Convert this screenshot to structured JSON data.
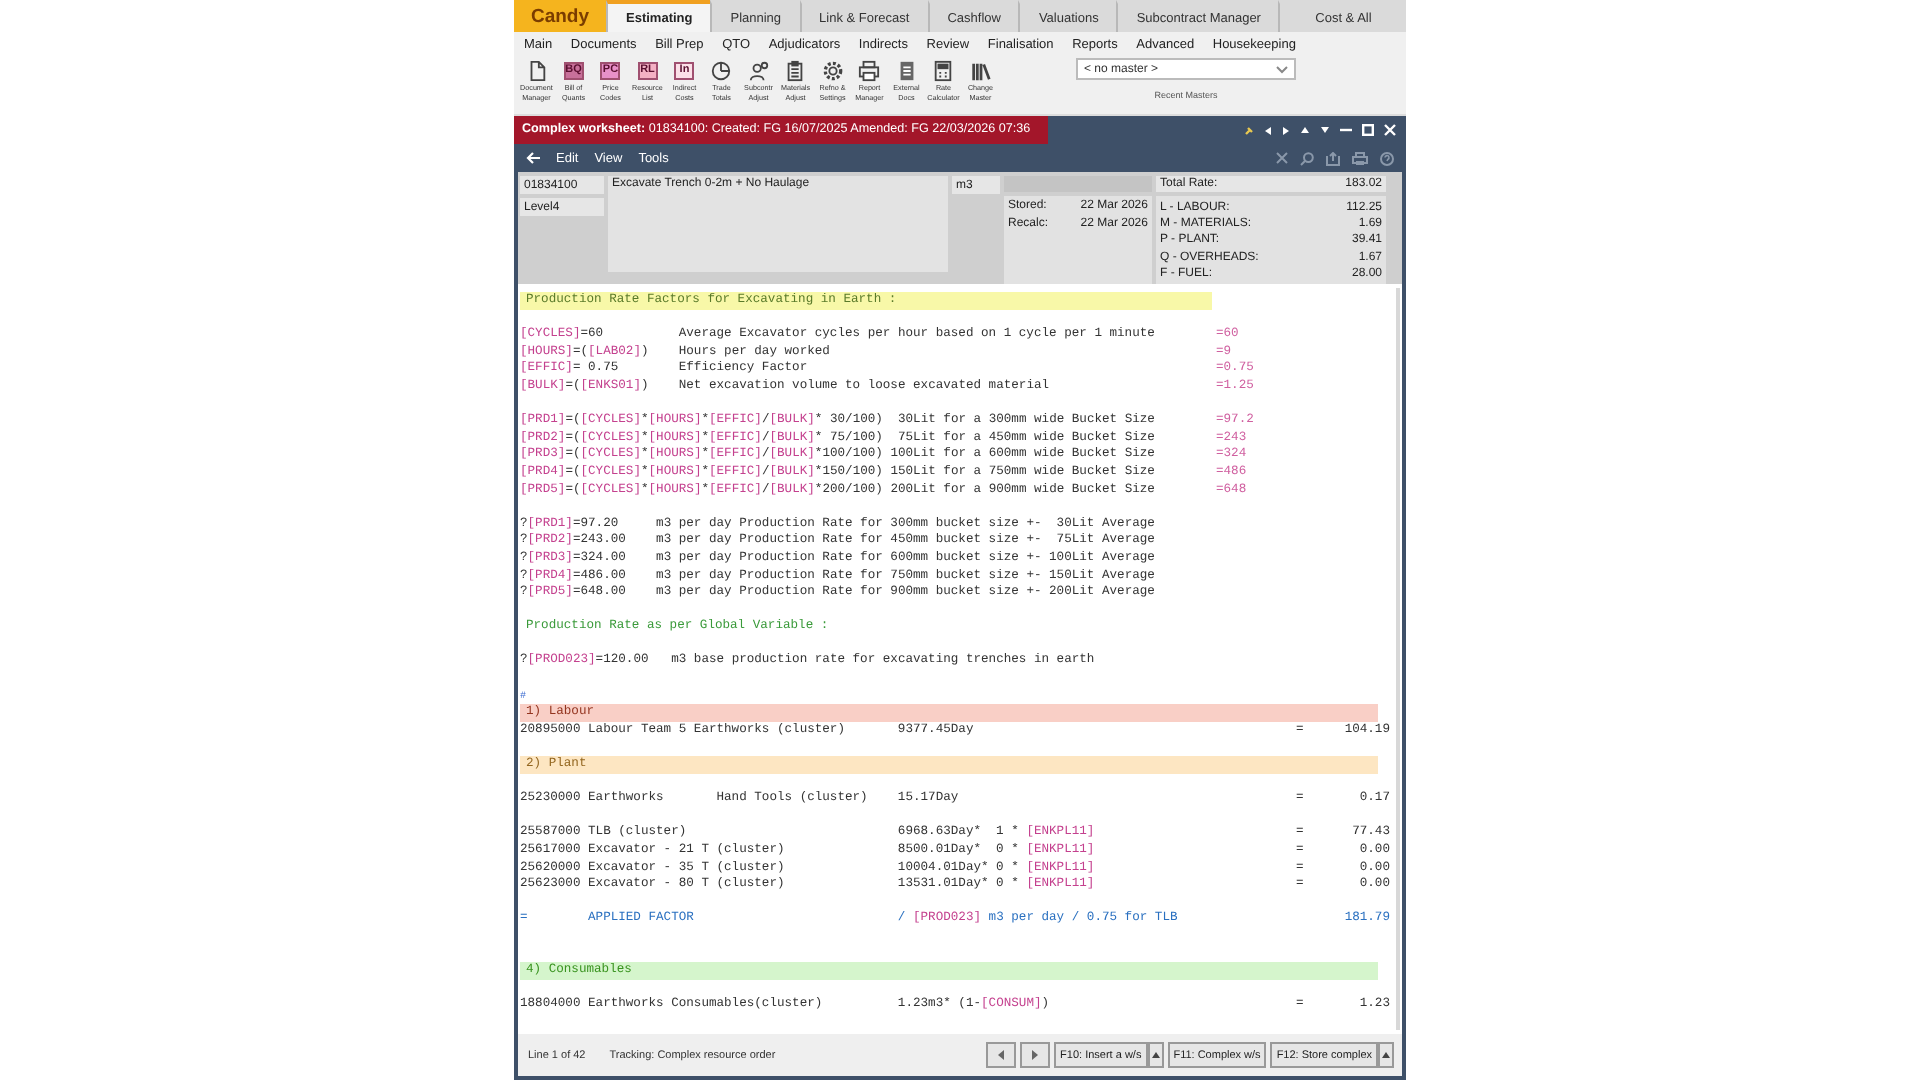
{
  "app": {
    "logo": "Candy"
  },
  "tabs": [
    {
      "label": "Estimating",
      "selected": true
    },
    {
      "label": "Planning",
      "selected": false
    },
    {
      "label": "Link & Forecast",
      "selected": false
    },
    {
      "label": "Cashflow",
      "selected": false
    },
    {
      "label": "Valuations",
      "selected": false
    },
    {
      "label": "Subcontract Manager",
      "selected": false
    },
    {
      "label": "Cost & All",
      "selected": false
    }
  ],
  "menu": [
    "Main",
    "Documents",
    "Bill Prep",
    "QTO",
    "Adjudicators",
    "Indirects",
    "Review",
    "Finalisation",
    "Reports",
    "Advanced",
    "Housekeeping"
  ],
  "ribbon": {
    "tools": [
      {
        "label": "Document Manager",
        "kind": "document"
      },
      {
        "label": "Bill of Quants",
        "kind": "badge",
        "badge": "BQ",
        "color": "#c8709a"
      },
      {
        "label": "Price Codes",
        "kind": "badge",
        "badge": "PC",
        "color": "#e890c8"
      },
      {
        "label": "Resource List",
        "kind": "badge",
        "badge": "RL",
        "color": "#f4b0c4"
      },
      {
        "label": "Indirect Costs",
        "kind": "badge",
        "badge": "In",
        "color": "#fbe0e8"
      },
      {
        "label": "Trade Totals",
        "kind": "pie"
      },
      {
        "label": "Subcontr Adjust",
        "kind": "people"
      },
      {
        "label": "Materials Adjust",
        "kind": "clipboard"
      },
      {
        "label": "Refno & Settings",
        "kind": "gear"
      },
      {
        "label": "Report Manager",
        "kind": "printer"
      },
      {
        "label": "External Docs",
        "kind": "file"
      },
      {
        "label": "Rate Calculator",
        "kind": "calculator"
      },
      {
        "label": "Change Master",
        "kind": "books"
      }
    ],
    "master_select": {
      "value": "< no master >"
    },
    "caption": "Recent Masters"
  },
  "worksheet": {
    "title": "**Complex worksheet:** 01834100: Created: FG 16/07/2025 Amended: FG 22/03/2026 07:36",
    "menu": [
      "Edit",
      "View",
      "Tools"
    ],
    "header": {
      "code": "01834100",
      "level": "Level4",
      "description": "Excavate Trench 0-2m + No Haulage",
      "unit": "m3",
      "dates": [
        {
          "label": "Stored:",
          "value": "22 Mar 2026"
        },
        {
          "label": "Recalc:",
          "value": "22 Mar 2026"
        }
      ],
      "total": {
        "label": "Total Rate:",
        "value": "183.02"
      },
      "breakdown": [
        {
          "label": "L - LABOUR:",
          "value": "112.25"
        },
        {
          "label": "M - MATERIALS:",
          "value": "1.69"
        },
        {
          "label": "P - PLANT:",
          "value": "39.41"
        },
        {
          "label": "Q - OVERHEADS:",
          "value": "1.67"
        },
        {
          "label": "F - FUEL:",
          "value": "28.00"
        }
      ]
    },
    "lines": [
      {
        "kind": "heading",
        "text": "Production Rate Factors for Excavating in Earth :"
      },
      {
        "kind": "blank"
      },
      {
        "kind": "code",
        "segments": [
          {
            "kind": "var",
            "text": "[CYCLES]"
          },
          {
            "kind": "text",
            "text": "=60          Average Excavator cycles per hour based on 1 cycle per 1 minute"
          }
        ],
        "result": "=60"
      },
      {
        "kind": "code",
        "segments": [
          {
            "kind": "var",
            "text": "[HOURS]"
          },
          {
            "kind": "text",
            "text": "=("
          },
          {
            "kind": "var",
            "text": "[LAB02]"
          },
          {
            "kind": "text",
            "text": ")    Hours per day worked"
          }
        ],
        "result": "=9"
      },
      {
        "kind": "code",
        "segments": [
          {
            "kind": "var",
            "text": "[EFFIC]"
          },
          {
            "kind": "text",
            "text": "= 0.75        Efficiency Factor"
          }
        ],
        "result": "=0.75"
      },
      {
        "kind": "code",
        "segments": [
          {
            "kind": "var",
            "text": "[BULK]"
          },
          {
            "kind": "text",
            "text": "=("
          },
          {
            "kind": "var",
            "text": "[ENKS01]"
          },
          {
            "kind": "text",
            "text": ")    Net excavation volume to loose excavated material"
          }
        ],
        "result": "=1.25"
      },
      {
        "kind": "blank"
      },
      {
        "kind": "code",
        "segments": [
          {
            "kind": "var",
            "text": "[PRD1]"
          },
          {
            "kind": "text",
            "text": "=("
          },
          {
            "kind": "var",
            "text": "[CYCLES]"
          },
          {
            "kind": "text",
            "text": "*"
          },
          {
            "kind": "var",
            "text": "[HOURS]"
          },
          {
            "kind": "text",
            "text": "*"
          },
          {
            "kind": "var",
            "text": "[EFFIC]"
          },
          {
            "kind": "text",
            "text": "/"
          },
          {
            "kind": "var",
            "text": "[BULK]"
          },
          {
            "kind": "text",
            "text": "* 30/100)  30Lit for a 300mm wide Bucket Size"
          }
        ],
        "result": "=97.2"
      },
      {
        "kind": "code",
        "segments": [
          {
            "kind": "var",
            "text": "[PRD2]"
          },
          {
            "kind": "text",
            "text": "=("
          },
          {
            "kind": "var",
            "text": "[CYCLES]"
          },
          {
            "kind": "text",
            "text": "*"
          },
          {
            "kind": "var",
            "text": "[HOURS]"
          },
          {
            "kind": "text",
            "text": "*"
          },
          {
            "kind": "var",
            "text": "[EFFIC]"
          },
          {
            "kind": "text",
            "text": "/"
          },
          {
            "kind": "var",
            "text": "[BULK]"
          },
          {
            "kind": "text",
            "text": "* 75/100)  75Lit for a 450mm wide Bucket Size"
          }
        ],
        "result": "=243"
      },
      {
        "kind": "code",
        "segments": [
          {
            "kind": "var",
            "text": "[PRD3]"
          },
          {
            "kind": "text",
            "text": "=("
          },
          {
            "kind": "var",
            "text": "[CYCLES]"
          },
          {
            "kind": "text",
            "text": "*"
          },
          {
            "kind": "var",
            "text": "[HOURS]"
          },
          {
            "kind": "text",
            "text": "*"
          },
          {
            "kind": "var",
            "text": "[EFFIC]"
          },
          {
            "kind": "text",
            "text": "/"
          },
          {
            "kind": "var",
            "text": "[BULK]"
          },
          {
            "kind": "text",
            "text": "*100/100) 100Lit for a 600mm wide Bucket Size"
          }
        ],
        "result": "=324"
      },
      {
        "kind": "code",
        "segments": [
          {
            "kind": "var",
            "text": "[PRD4]"
          },
          {
            "kind": "text",
            "text": "=("
          },
          {
            "kind": "var",
            "text": "[CYCLES]"
          },
          {
            "kind": "text",
            "text": "*"
          },
          {
            "kind": "var",
            "text": "[HOURS]"
          },
          {
            "kind": "text",
            "text": "*"
          },
          {
            "kind": "var",
            "text": "[EFFIC]"
          },
          {
            "kind": "text",
            "text": "/"
          },
          {
            "kind": "var",
            "text": "[BULK]"
          },
          {
            "kind": "text",
            "text": "*150/100) 150Lit for a 750mm wide Bucket Size"
          }
        ],
        "result": "=486"
      },
      {
        "kind": "code",
        "segments": [
          {
            "kind": "var",
            "text": "[PRD5]"
          },
          {
            "kind": "text",
            "text": "=("
          },
          {
            "kind": "var",
            "text": "[CYCLES]"
          },
          {
            "kind": "text",
            "text": "*"
          },
          {
            "kind": "var",
            "text": "[HOURS]"
          },
          {
            "kind": "text",
            "text": "*"
          },
          {
            "kind": "var",
            "text": "[EFFIC]"
          },
          {
            "kind": "text",
            "text": "/"
          },
          {
            "kind": "var",
            "text": "[BULK]"
          },
          {
            "kind": "text",
            "text": "*200/100) 200Lit for a 900mm wide Bucket Size"
          }
        ],
        "result": "=648"
      },
      {
        "kind": "blank"
      },
      {
        "kind": "code",
        "segments": [
          {
            "kind": "text",
            "text": "?"
          },
          {
            "kind": "var",
            "text": "[PRD1]"
          },
          {
            "kind": "text",
            "text": "=97.20     m3 per day Production Rate for 300mm bucket size +-  30Lit Average"
          }
        ]
      },
      {
        "kind": "code",
        "segments": [
          {
            "kind": "text",
            "text": "?"
          },
          {
            "kind": "var",
            "text": "[PRD2]"
          },
          {
            "kind": "text",
            "text": "=243.00    m3 per day Production Rate for 450mm bucket size +-  75Lit Average"
          }
        ]
      },
      {
        "kind": "code",
        "segments": [
          {
            "kind": "text",
            "text": "?"
          },
          {
            "kind": "var",
            "text": "[PRD3]"
          },
          {
            "kind": "text",
            "text": "=324.00    m3 per day Production Rate for 600mm bucket size +- 100Lit Average"
          }
        ]
      },
      {
        "kind": "code",
        "segments": [
          {
            "kind": "text",
            "text": "?"
          },
          {
            "kind": "var",
            "text": "[PRD4]"
          },
          {
            "kind": "text",
            "text": "=486.00    m3 per day Production Rate for 750mm bucket size +- 150Lit Average"
          }
        ]
      },
      {
        "kind": "code",
        "segments": [
          {
            "kind": "text",
            "text": "?"
          },
          {
            "kind": "var",
            "text": "[PRD5]"
          },
          {
            "kind": "text",
            "text": "=648.00    m3 per day Production Rate for 900mm bucket size +- 200Lit Average"
          }
        ]
      },
      {
        "kind": "blank"
      },
      {
        "kind": "note",
        "text": "Production Rate as per Global Variable :"
      },
      {
        "kind": "blank"
      },
      {
        "kind": "code",
        "segments": [
          {
            "kind": "text",
            "text": "?"
          },
          {
            "kind": "var",
            "text": "[PROD023]"
          },
          {
            "kind": "text",
            "text": "=120.00   m3 base production rate for excavating trenches in earth"
          }
        ]
      },
      {
        "kind": "blank"
      },
      {
        "kind": "cursor",
        "text": "#"
      },
      {
        "kind": "section",
        "text": "1) Labour",
        "color": "#f9cfc6"
      },
      {
        "kind": "code",
        "segments": [
          {
            "kind": "text",
            "text": "20895000 Labour Team 5 Earthworks (cluster)       9377.45Day"
          }
        ],
        "eq": "=",
        "amount": "104.19"
      },
      {
        "kind": "blank"
      },
      {
        "kind": "section",
        "text": "2) Plant",
        "color": "#fde6c2"
      },
      {
        "kind": "blank"
      },
      {
        "kind": "code",
        "segments": [
          {
            "kind": "text",
            "text": "25230000 Earthworks       Hand Tools (cluster)    15.17Day"
          }
        ],
        "eq": "=",
        "amount": "0.17"
      },
      {
        "kind": "blank"
      },
      {
        "kind": "code",
        "segments": [
          {
            "kind": "text",
            "text": "25587000 TLB (cluster)                            6968.63Day*  1 * "
          },
          {
            "kind": "var",
            "text": "[ENKPL11]"
          }
        ],
        "eq": "=",
        "amount": "77.43"
      },
      {
        "kind": "code",
        "segments": [
          {
            "kind": "text",
            "text": "25617000 Excavator - 21 T (cluster)               8500.01Day*  0 * "
          },
          {
            "kind": "var",
            "text": "[ENKPL11]"
          }
        ],
        "eq": "=",
        "amount": "0.00"
      },
      {
        "kind": "code",
        "segments": [
          {
            "kind": "text",
            "text": "25620000 Excavator - 35 T (cluster)               10004.01Day* 0 * "
          },
          {
            "kind": "var",
            "text": "[ENKPL11]"
          }
        ],
        "eq": "=",
        "amount": "0.00"
      },
      {
        "kind": "code",
        "segments": [
          {
            "kind": "text",
            "text": "25623000 Excavator - 80 T (cluster)               13531.01Day* 0 * "
          },
          {
            "kind": "var",
            "text": "[ENKPL11]"
          }
        ],
        "eq": "=",
        "amount": "0.00"
      },
      {
        "kind": "blank"
      },
      {
        "kind": "factor",
        "segments": [
          {
            "kind": "text",
            "text": "=        APPLIED FACTOR                           / "
          },
          {
            "kind": "var",
            "text": "[PROD023]"
          },
          {
            "kind": "text",
            "text": " m3 per day / 0.75 for TLB"
          }
        ],
        "amount": "181.79"
      },
      {
        "kind": "blank"
      },
      {
        "kind": "blank"
      },
      {
        "kind": "section",
        "text": "4) Consumables",
        "color": "#d5f5cc"
      },
      {
        "kind": "blank"
      },
      {
        "kind": "code",
        "segments": [
          {
            "kind": "text",
            "text": "18804000 Earthworks Consumables(cluster)          1.23m3* (1-"
          },
          {
            "kind": "var",
            "text": "[CONSUM]"
          },
          {
            "kind": "text",
            "text": ")"
          }
        ],
        "eq": "=",
        "amount": "1.23"
      }
    ],
    "status": {
      "position": "Line 1 of 42",
      "tracking": "Tracking: Complex resource order",
      "buttons": [
        {
          "label": "F10: Insert a w/s",
          "dropdown": true
        },
        {
          "label": "F11: Complex w/s",
          "dropdown": false
        },
        {
          "label": "F12: Store complex",
          "dropdown": true
        }
      ]
    }
  }
}
